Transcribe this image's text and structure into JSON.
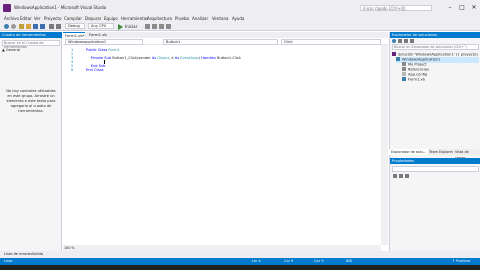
{
  "window": {
    "title": "WindowsApplication1 - Microsoft Visual Studio",
    "quick_launch_placeholder": "Inicio rápido (Ctrl+Q)",
    "minimize": "–",
    "maximize": "□",
    "close": "✕"
  },
  "menu": [
    "Archivo",
    "Editar",
    "Ver",
    "Proyecto",
    "Compilar",
    "Depurar",
    "Equipo",
    "Herramientas",
    "Arquitectura",
    "Prueba",
    "Analizar",
    "Ventana",
    "Ayuda"
  ],
  "toolbar": {
    "config": "Debug",
    "platform": "Any CPU",
    "start_label": "Iniciar"
  },
  "toolbox": {
    "title": "Cuadro de herramientas",
    "search_placeholder": "Buscar en el Cuadro de herramientas",
    "group": "▲ General",
    "empty_message": "No hay controles utilizables en este grupo. Arrastre un elemento a este texto para agregarlo al cuadro de herramientas."
  },
  "editor": {
    "tabs": [
      {
        "label": "Form1.vb*",
        "active": true
      },
      {
        "label": "Form1.vb [Diseño]*",
        "active": false
      }
    ],
    "nav_left": "Windowsapplication1",
    "nav_mid": "Button1",
    "nav_right": "Click",
    "lines": [
      {
        "n": "1",
        "text": "Public Class Form1"
      },
      {
        "n": "2",
        "text": ""
      },
      {
        "n": "3",
        "text": "    Private Sub Button1_Click(sender As Object, e As EventArgs) Handles Button1.Click"
      },
      {
        "n": "4",
        "text": ""
      },
      {
        "n": "5",
        "text": "    End Sub"
      },
      {
        "n": "6",
        "text": "End Class"
      }
    ],
    "zoom": "100 %"
  },
  "solution_explorer": {
    "title": "Explorador de soluciones",
    "search_placeholder": "Buscar en Explorador de soluciones (Ctrl+`)",
    "items": [
      {
        "label": "Solución 'WindowsApplication1' (1 proyecto)",
        "indent": 0
      },
      {
        "label": "WindowsApplication1",
        "indent": 1
      },
      {
        "label": "My Project",
        "indent": 2
      },
      {
        "label": "Referencias",
        "indent": 2
      },
      {
        "label": "App.config",
        "indent": 2
      },
      {
        "label": "Form1.vb",
        "indent": 2
      }
    ],
    "tabs": [
      "Explorador de solu...",
      "Team Explorer",
      "Vista de clases"
    ]
  },
  "properties": {
    "title": "Propiedades"
  },
  "bottom_tabs": [
    "Lista de errores",
    "Salida"
  ],
  "status": {
    "ready": "Listo",
    "line": "Lín 4",
    "col": "Col 9",
    "char": "Car 9",
    "mode": "INS",
    "publish": "↑ Publicar"
  },
  "colors": {
    "accent": "#007acc",
    "chrome": "#eeeef2",
    "keyword": "#0000ff",
    "type": "#2b91af"
  }
}
